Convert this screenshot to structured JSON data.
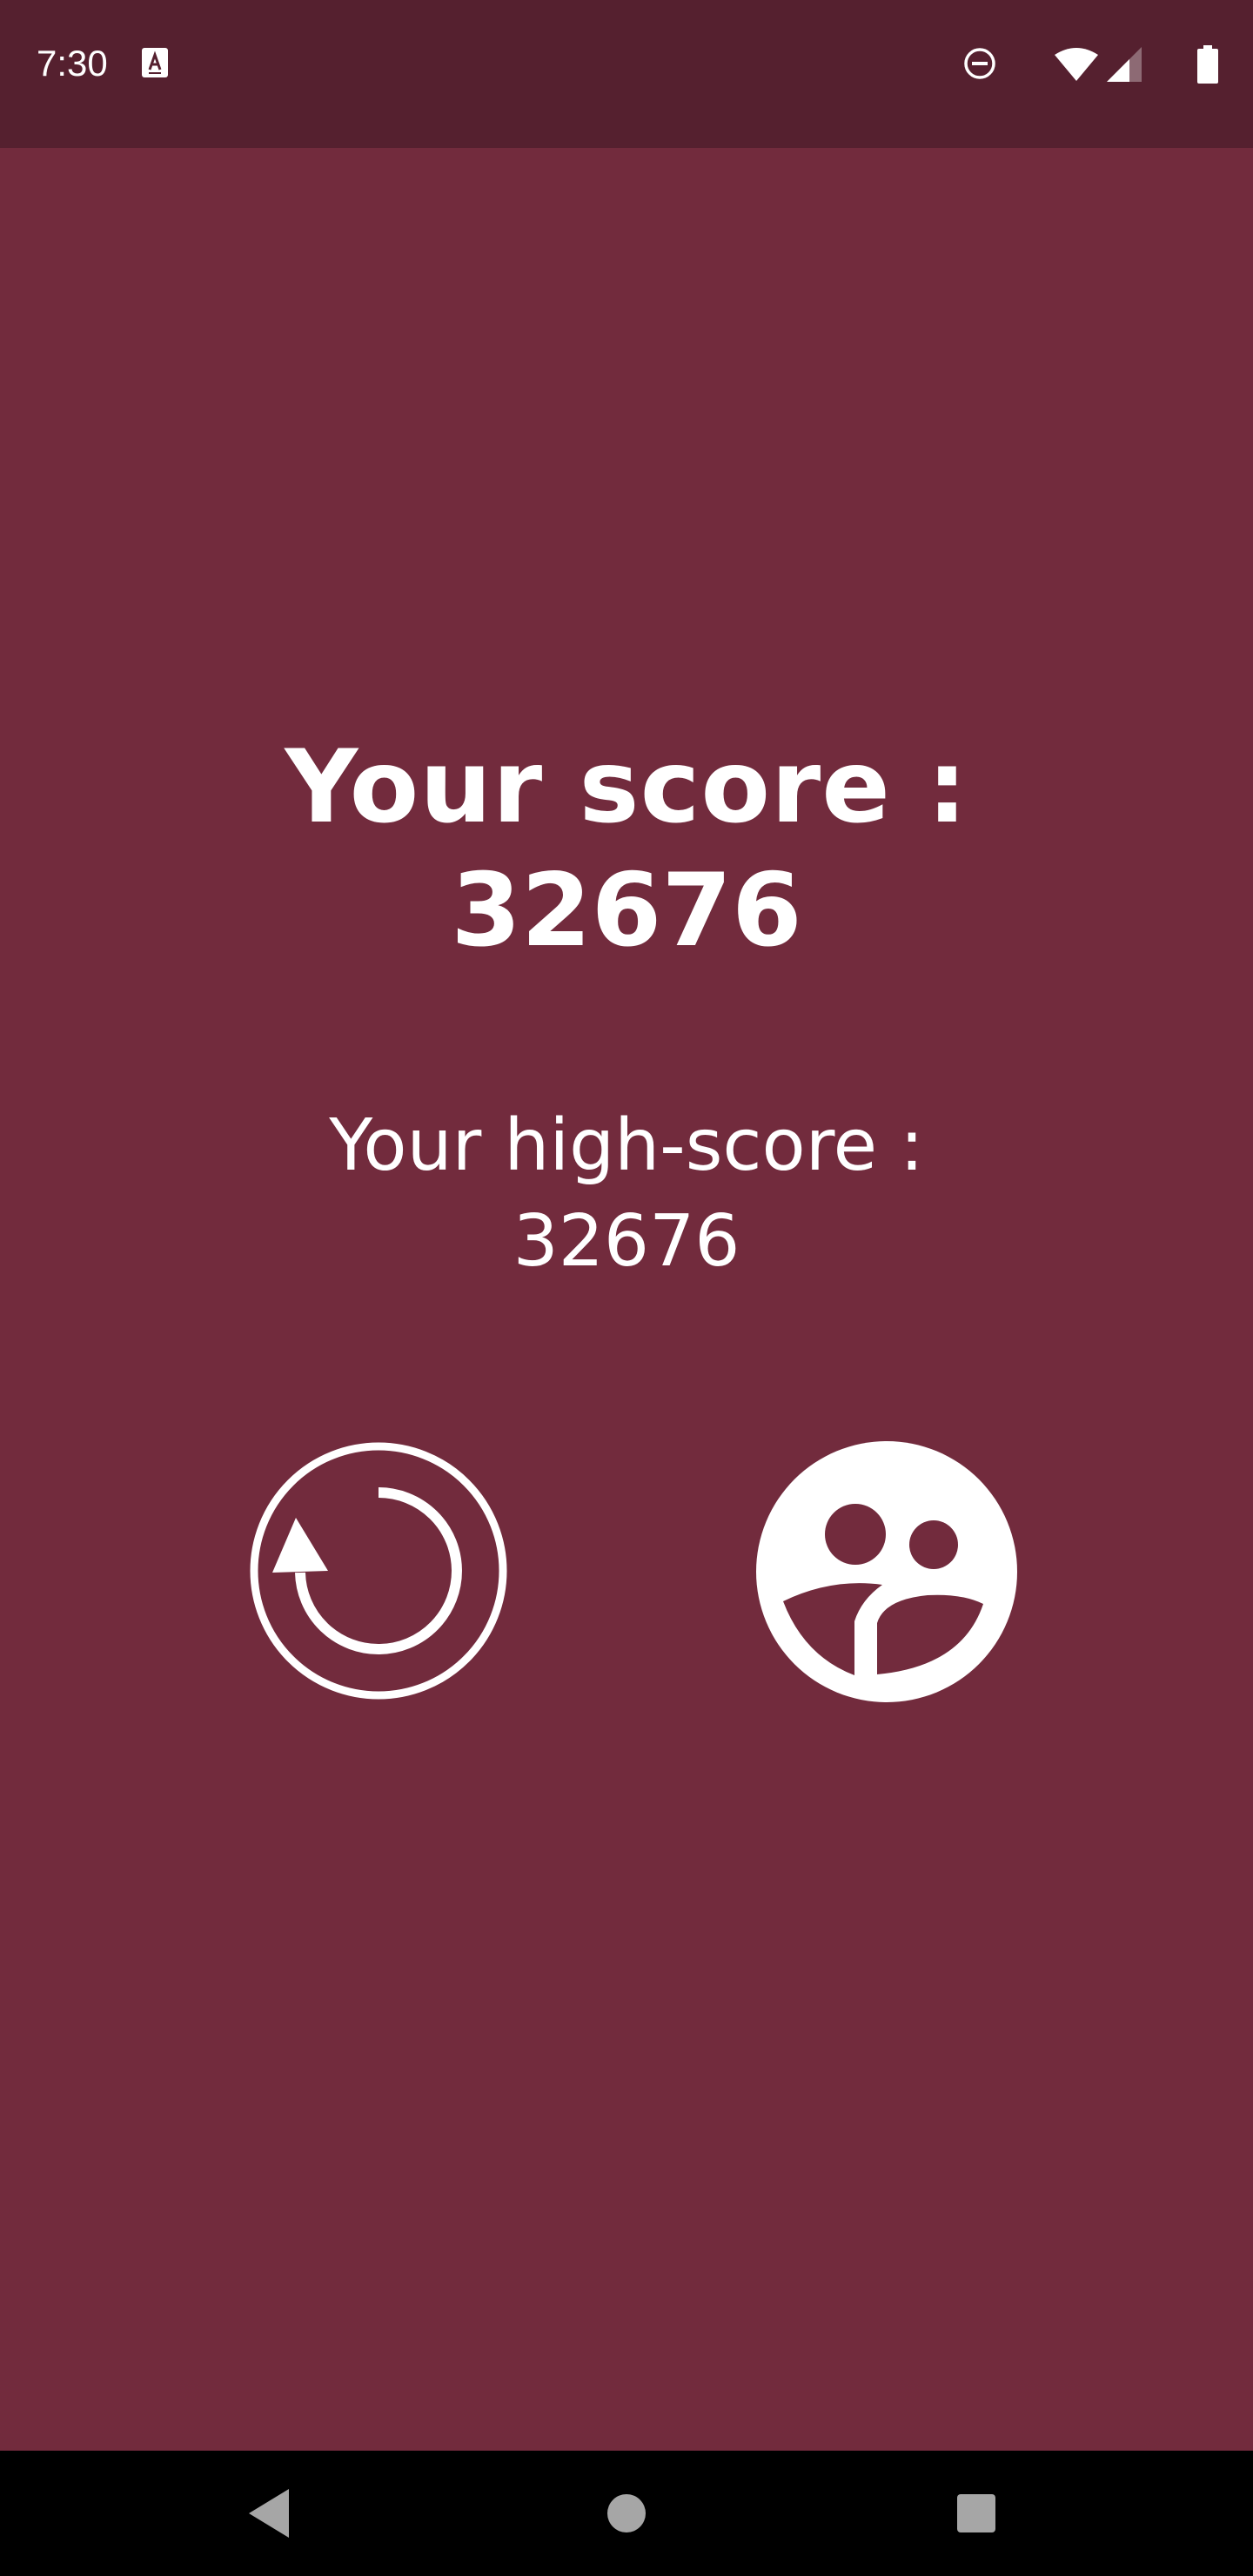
{
  "status_bar": {
    "time": "7:30",
    "icons": [
      "a-notification-icon",
      "do-not-disturb-icon",
      "wifi-icon",
      "cellular-signal-icon",
      "battery-icon"
    ]
  },
  "main": {
    "score_label": "Your score :",
    "score_value": "32676",
    "highscore_label": "Your high-score :",
    "highscore_value": "32676",
    "buttons": [
      {
        "name": "restart",
        "icon": "restart-icon"
      },
      {
        "name": "leaderboard",
        "icon": "leaderboard-people-icon"
      }
    ]
  },
  "nav_bar": {
    "buttons": [
      "back",
      "home",
      "recents"
    ]
  },
  "colors": {
    "background": "#722b3d",
    "status_bar": "#55202f",
    "text": "#ffffff",
    "nav_bar": "#000000",
    "nav_icons": "#a6a6a6"
  }
}
